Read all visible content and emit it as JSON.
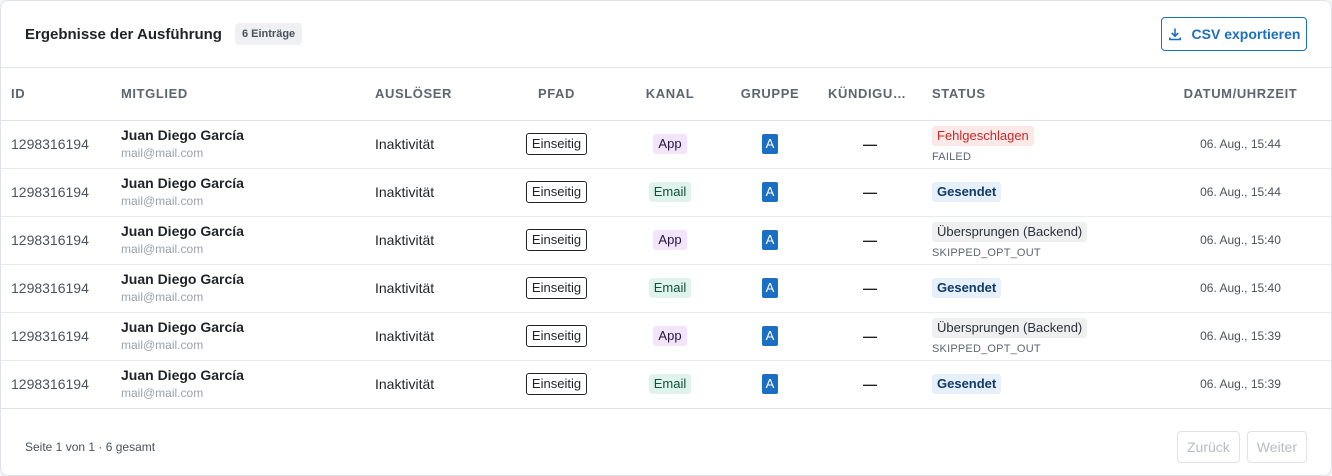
{
  "header": {
    "title": "Ergebnisse der Ausführung",
    "count_badge": "6 Einträge",
    "export_label": "CSV exportieren"
  },
  "table": {
    "columns": [
      "ID",
      "Mitglied",
      "Auslöser",
      "Pfad",
      "Kanal",
      "Gruppe",
      "Kündigun…",
      "Status",
      "Datum/Uhrzeit"
    ],
    "rows": [
      {
        "id": "1298316194",
        "name": "Juan Diego García",
        "email": "mail@mail.com",
        "trigger": "Inaktivität",
        "path": "Einseitig",
        "channel": "App",
        "group": "A",
        "cancel": "—",
        "status": "Fehlgeschlagen",
        "status_code": "FAILED",
        "date": "06. Aug., 15:44"
      },
      {
        "id": "1298316194",
        "name": "Juan Diego García",
        "email": "mail@mail.com",
        "trigger": "Inaktivität",
        "path": "Einseitig",
        "channel": "Email",
        "group": "A",
        "cancel": "—",
        "status": "Gesendet",
        "status_code": "",
        "date": "06. Aug., 15:44"
      },
      {
        "id": "1298316194",
        "name": "Juan Diego García",
        "email": "mail@mail.com",
        "trigger": "Inaktivität",
        "path": "Einseitig",
        "channel": "App",
        "group": "A",
        "cancel": "—",
        "status": "Übersprungen (Backend)",
        "status_code": "SKIPPED_OPT_OUT",
        "date": "06. Aug., 15:40"
      },
      {
        "id": "1298316194",
        "name": "Juan Diego García",
        "email": "mail@mail.com",
        "trigger": "Inaktivität",
        "path": "Einseitig",
        "channel": "Email",
        "group": "A",
        "cancel": "—",
        "status": "Gesendet",
        "status_code": "",
        "date": "06. Aug., 15:40"
      },
      {
        "id": "1298316194",
        "name": "Juan Diego García",
        "email": "mail@mail.com",
        "trigger": "Inaktivität",
        "path": "Einseitig",
        "channel": "App",
        "group": "A",
        "cancel": "—",
        "status": "Übersprungen (Backend)",
        "status_code": "SKIPPED_OPT_OUT",
        "date": "06. Aug., 15:39"
      },
      {
        "id": "1298316194",
        "name": "Juan Diego García",
        "email": "mail@mail.com",
        "trigger": "Inaktivität",
        "path": "Einseitig",
        "channel": "Email",
        "group": "A",
        "cancel": "—",
        "status": "Gesendet",
        "status_code": "",
        "date": "06. Aug., 15:39"
      }
    ]
  },
  "footer": {
    "page_info": "Seite 1 von 1 · 6 gesamt",
    "prev_label": "Zurück",
    "next_label": "Weiter"
  },
  "colors": {
    "accent": "#1a6fc2",
    "failed": "#c62828",
    "app_channel_bg": "#f1e4fb",
    "email_channel_bg": "#dff3ec"
  },
  "icons": {
    "export": "download-icon"
  }
}
